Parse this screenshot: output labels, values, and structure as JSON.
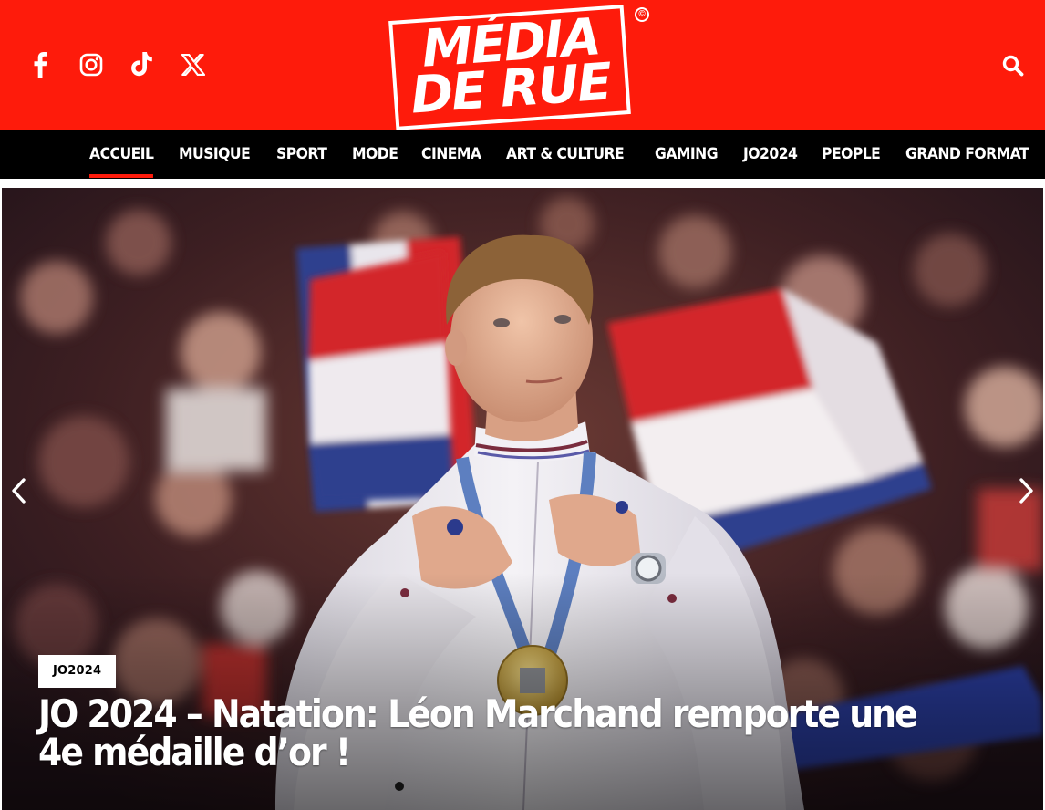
{
  "header": {
    "background_color": "#fe1b0b",
    "logo": {
      "line1": "MÉDIA",
      "line2": "DE RUE",
      "copyright": "©"
    },
    "socials": [
      {
        "name": "facebook-icon",
        "glyph": "f"
      },
      {
        "name": "instagram-icon",
        "glyph": "instagram"
      },
      {
        "name": "tiktok-icon",
        "glyph": "♪"
      },
      {
        "name": "x-twitter-icon",
        "glyph": "𝕏"
      }
    ],
    "search_icon": "search-icon"
  },
  "nav": {
    "items": [
      {
        "label": "ACCUEIL",
        "active": true
      },
      {
        "label": "MUSIQUE"
      },
      {
        "label": "SPORT"
      },
      {
        "label": "MODE"
      },
      {
        "label": "CINEMA"
      },
      {
        "label": "ART & CULTURE"
      },
      {
        "label": "GAMING"
      },
      {
        "label": "JO2024"
      },
      {
        "label": "PEOPLE"
      },
      {
        "label": "GRAND FORMAT"
      }
    ],
    "active_underline_color": "#fe1b0b"
  },
  "hero": {
    "category": "JO2024",
    "title": "JO 2024 – Natation: Léon Marchand remporte une 4e médaille d’or !",
    "prev_icon": "chevron-left-icon",
    "next_icon": "chevron-right-icon"
  }
}
